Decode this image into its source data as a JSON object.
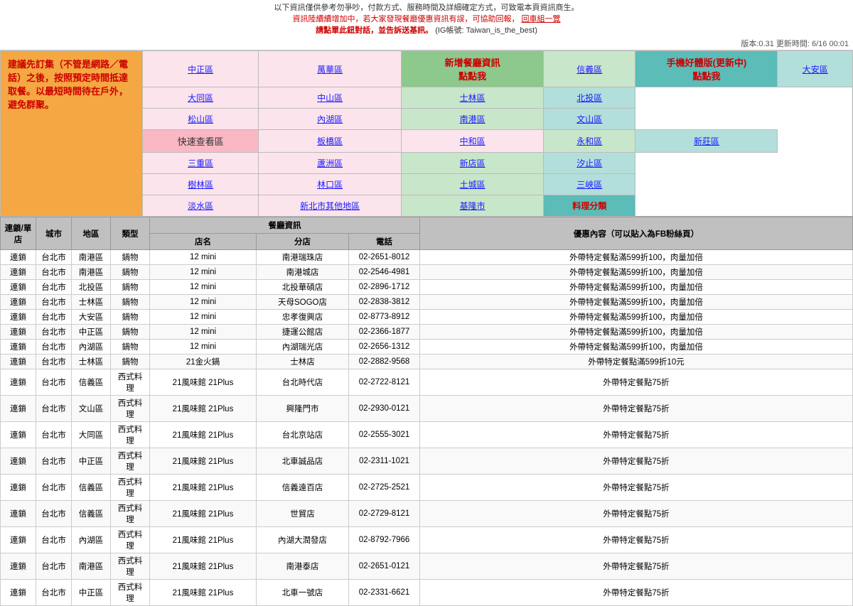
{
  "topNotice": {
    "line1": "以下資訊僅供參考勿爭吵，付款方式、服務時間及詳細確定方式，可致電本頁資訊商生。",
    "line2Red": "資訊陸續續增加中，若大家發現餐廳優惠資訊有誤，可協助回報，",
    "line2Link": "回車組一覽",
    "line3Highlight": "請點單此鈕對話，並告訴送基訊。",
    "line3Sub": "(IG帳號: Taiwan_is_the_best)"
  },
  "version": "版本:0.31 更新時間: 6/16 00:01",
  "navHeaders": {
    "col1": "建議先訂集（不管是網路／電話）之後，按照預定時間抵達取餐。以最短時間待在戶外，避免群聚。",
    "col2": "新增餐廳資訊\n點點我",
    "col3": "手機好體版(更新中)\n點點我"
  },
  "quickArea": "快速查看區",
  "navRows": [
    [
      "中正區",
      "萬華區",
      "信義區",
      "大安區"
    ],
    [
      "大同區",
      "中山區",
      "士林區",
      "北投區"
    ],
    [
      "松山區",
      "內湖區",
      "南港區",
      "文山區"
    ],
    [
      "板橋區",
      "中和區",
      "永和區",
      "新莊區"
    ],
    [
      "三重區",
      "蘆洲區",
      "新店區",
      "汐止區"
    ],
    [
      "樹林區",
      "林口區",
      "土城區",
      "三峽區"
    ],
    [
      "淡水區",
      "新北市其他地區",
      "基隆市",
      "料理分類"
    ]
  ],
  "tableHeaders": {
    "chain": "連鎖/單店",
    "city": "城市",
    "district": "地區",
    "type": "類型",
    "restaurantInfo": "餐廳資訊",
    "name": "店名",
    "branch": "分店",
    "promo": "優惠內容（可以貼入為FB粉絲頁）"
  },
  "rows": [
    [
      "連鎖",
      "台北市",
      "南港區",
      "鍋物",
      "12 mini",
      "南港瑞珠店",
      "02-2651-8012",
      "外帶特定餐點滿599折100，肉量加倍"
    ],
    [
      "連鎖",
      "台北市",
      "南港區",
      "鍋物",
      "12 mini",
      "南港城店",
      "02-2546-4981",
      "外帶特定餐點滿599折100，肉量加倍"
    ],
    [
      "連鎖",
      "台北市",
      "北投區",
      "鍋物",
      "12 mini",
      "北投華碩店",
      "02-2896-1712",
      "外帶特定餐點滿599折100，肉量加倍"
    ],
    [
      "連鎖",
      "台北市",
      "士林區",
      "鍋物",
      "12 mini",
      "天母SOGO店",
      "02-2838-3812",
      "外帶特定餐點滿599折100，肉量加倍"
    ],
    [
      "連鎖",
      "台北市",
      "大安區",
      "鍋物",
      "12 mini",
      "忠孝復興店",
      "02-8773-8912",
      "外帶特定餐點滿599折100，肉量加倍"
    ],
    [
      "連鎖",
      "台北市",
      "中正區",
      "鍋物",
      "12 mini",
      "捷運公館店",
      "02-2366-1877",
      "外帶特定餐點滿599折100，肉量加倍"
    ],
    [
      "連鎖",
      "台北市",
      "內湖區",
      "鍋物",
      "12 mini",
      "內湖瑞光店",
      "02-2656-1312",
      "外帶特定餐點滿599折100，肉量加倍"
    ],
    [
      "連鎖",
      "台北市",
      "士林區",
      "鍋物",
      "21金火鍋",
      "士林店",
      "02-2882-9568",
      "外帶特定餐點滿599折10元"
    ],
    [
      "連鎖",
      "台北市",
      "信義區",
      "西式料理",
      "21風味館 21Plus",
      "台北時代店",
      "02-2722-8121",
      "外帶特定餐點75折"
    ],
    [
      "連鎖",
      "台北市",
      "文山區",
      "西式料理",
      "21風味館 21Plus",
      "興隆門市",
      "02-2930-0121",
      "外帶特定餐點75折"
    ],
    [
      "連鎖",
      "台北市",
      "大同區",
      "西式料理",
      "21風味館 21Plus",
      "台北京站店",
      "02-2555-3021",
      "外帶特定餐點75折"
    ],
    [
      "連鎖",
      "台北市",
      "中正區",
      "西式料理",
      "21風味館 21Plus",
      "北車誠品店",
      "02-2311-1021",
      "外帶特定餐點75折"
    ],
    [
      "連鎖",
      "台北市",
      "信義區",
      "西式料理",
      "21風味館 21Plus",
      "信義遠百店",
      "02-2725-2521",
      "外帶特定餐點75折"
    ],
    [
      "連鎖",
      "台北市",
      "信義區",
      "西式料理",
      "21風味館 21Plus",
      "世貿店",
      "02-2729-8121",
      "外帶特定餐點75折"
    ],
    [
      "連鎖",
      "台北市",
      "內湖區",
      "西式料理",
      "21風味館 21Plus",
      "內湖大潤發店",
      "02-8792-7966",
      "外帶特定餐點75折"
    ],
    [
      "連鎖",
      "台北市",
      "南港區",
      "西式料理",
      "21風味館 21Plus",
      "南港泰店",
      "02-2651-0121",
      "外帶特定餐點75折"
    ],
    [
      "連鎖",
      "台北市",
      "中正區",
      "西式料理",
      "21風味館 21Plus",
      "北車一號店",
      "02-2331-6621",
      "外帶特定餐點75折"
    ]
  ]
}
